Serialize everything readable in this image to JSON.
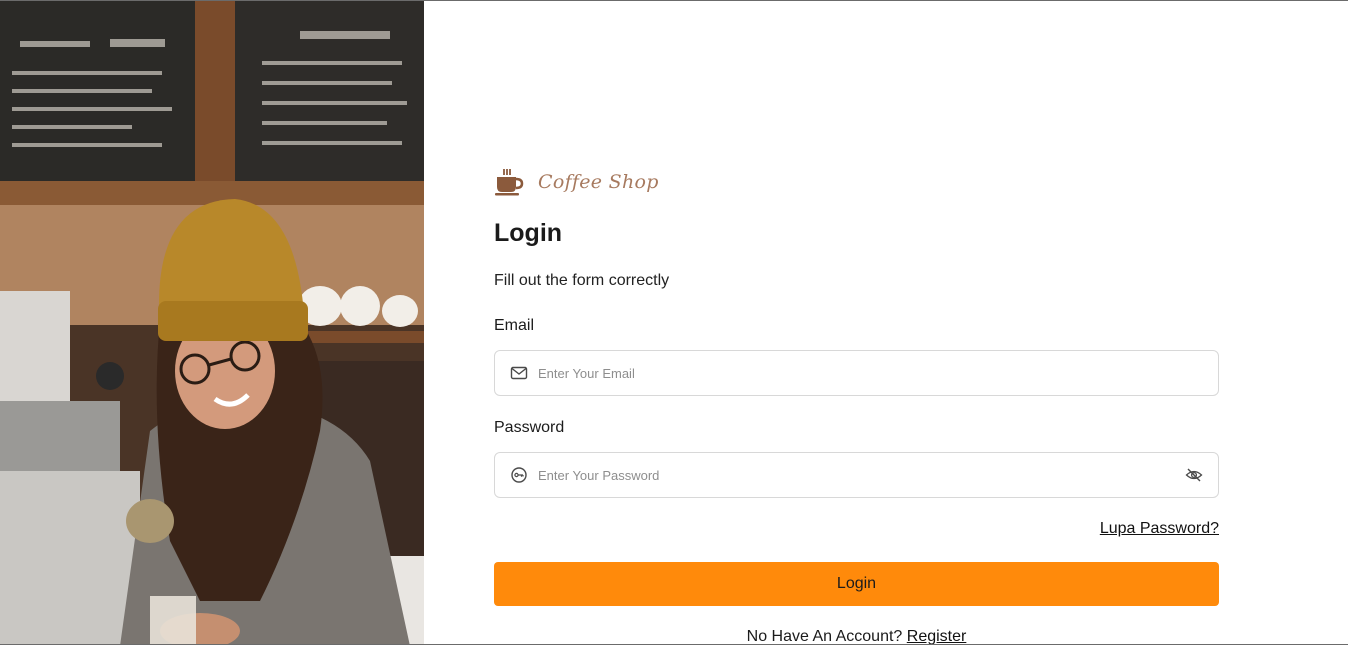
{
  "brand": {
    "name": "Coffee Shop",
    "logo_icon": "coffee-cup-icon",
    "color": "#a77a5f"
  },
  "hero": {
    "description_icon": "barista-photo"
  },
  "form": {
    "title": "Login",
    "subtitle": "Fill out the form correctly",
    "email": {
      "label": "Email",
      "placeholder": "Enter Your Email",
      "value": "",
      "icon": "mail-icon"
    },
    "password": {
      "label": "Password",
      "placeholder": "Enter Your Password",
      "value": "",
      "icon": "key-icon",
      "toggle_icon": "eye-off-icon"
    },
    "forgot_label": "Lupa Password?",
    "login_label": "Login",
    "register_prompt": "No Have An Account?",
    "register_label": "Register"
  },
  "colors": {
    "accent": "#ff8a0b",
    "border": "#d8d8d8",
    "text": "#1b1b1b"
  }
}
